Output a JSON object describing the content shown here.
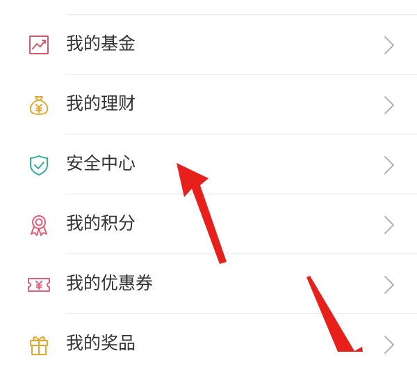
{
  "menu": {
    "items": [
      {
        "label": "我的基金",
        "icon": "fund-chart-icon",
        "color": "#d8566b"
      },
      {
        "label": "我的理财",
        "icon": "money-bag-icon",
        "color": "#e3a72f"
      },
      {
        "label": "安全中心",
        "icon": "shield-check-icon",
        "color": "#2fae99"
      },
      {
        "label": "我的积分",
        "icon": "award-ribbon-icon",
        "color": "#e0607c"
      },
      {
        "label": "我的优惠券",
        "icon": "coupon-ticket-icon",
        "color": "#e0607c"
      },
      {
        "label": "我的奖品",
        "icon": "gift-box-icon",
        "color": "#e3a72f"
      }
    ]
  },
  "colors": {
    "text": "#333333",
    "divider": "#e5e5e5",
    "chevron": "#b3b3b3",
    "annotation_arrow": "#e8201c"
  },
  "annotations": [
    {
      "type": "arrow",
      "icon": "red-arrow-icon",
      "points_to": "安全中心"
    },
    {
      "type": "arrow",
      "icon": "red-arrow-icon",
      "points_to": "我的奖品"
    }
  ]
}
